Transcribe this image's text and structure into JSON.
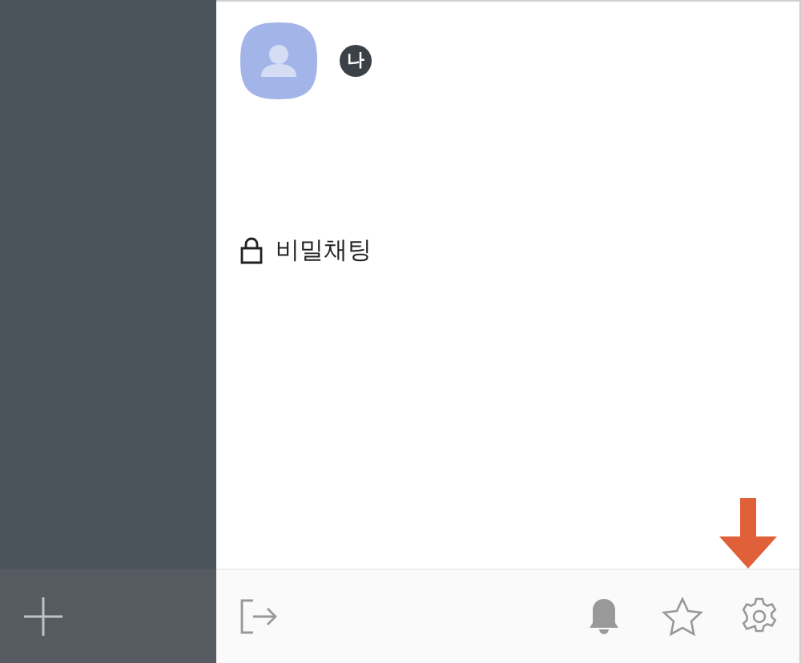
{
  "profile": {
    "badge": "나"
  },
  "menu": [
    {
      "label": "비밀채팅"
    }
  ]
}
